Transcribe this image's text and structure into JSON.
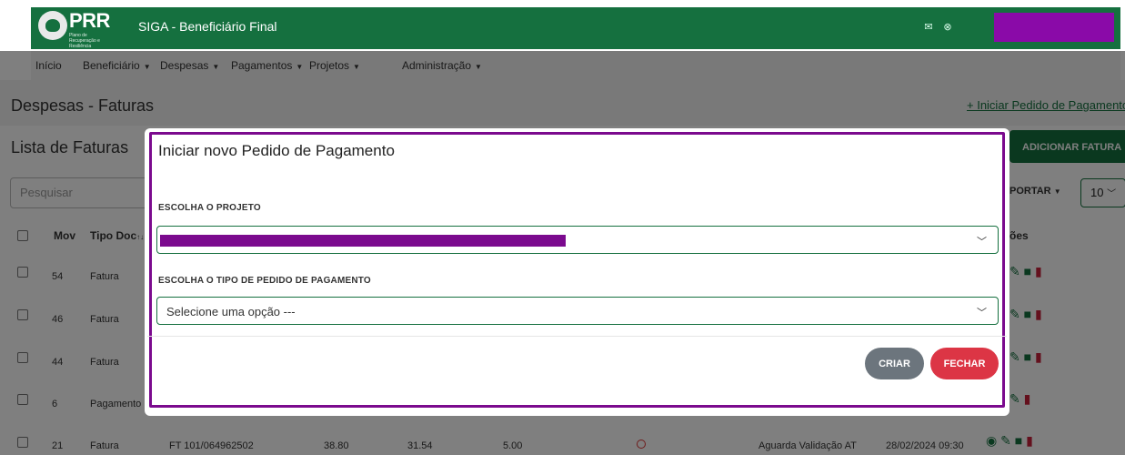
{
  "header": {
    "logo_text": "PRR",
    "logo_subtitle": "Plano de Recuperação e Resiliência",
    "app_title": "SIGA - Beneficiário Final",
    "mail_icon": "envelope-icon",
    "close_icon": "circle-x-icon",
    "user_redaction_color": "#8a0aa8"
  },
  "nav": {
    "items": [
      {
        "label": "Início"
      },
      {
        "label": "Beneficiário"
      },
      {
        "label": "Despesas"
      },
      {
        "label": "Pagamentos"
      },
      {
        "label": "Projetos"
      },
      {
        "label": "Administração"
      }
    ]
  },
  "page": {
    "title": "Despesas - Faturas",
    "link": "+ Iniciar Pedido de Pagamento",
    "list_title": "Lista de Faturas",
    "add_button": "ADICIONAR FATURA",
    "search_placeholder": "Pesquisar",
    "export": "PORTAR",
    "page_size": "10"
  },
  "table": {
    "headers": {
      "mov": "Mov",
      "tipo": "Tipo Doc",
      "acoes": "ões"
    },
    "rows": [
      {
        "mov": "54",
        "tipo": "Fatura"
      },
      {
        "mov": "46",
        "tipo": "Fatura"
      },
      {
        "mov": "44",
        "tipo": "Fatura"
      },
      {
        "mov": "6",
        "tipo": "Pagamento"
      },
      {
        "mov": "21",
        "tipo": "Fatura",
        "doc": "FT 101/064962502",
        "v1": "38.80",
        "v2": "31.54",
        "v3": "5.00",
        "estado": "Aguarda Validação AT",
        "data": "28/02/2024 09:30"
      }
    ]
  },
  "modal": {
    "title": "Iniciar novo Pedido de Pagamento",
    "project_label": "ESCOLHA O PROJETO",
    "type_label": "ESCOLHA O TIPO DE PEDIDO DE PAGAMENTO",
    "type_placeholder": "Selecione uma opção ---",
    "create_button": "CRIAR",
    "close_button": "FECHAR",
    "accent_color": "#7b0a8e"
  },
  "colors": {
    "brand_green": "#15703f",
    "danger": "#dc3545",
    "secondary": "#6c757d"
  }
}
